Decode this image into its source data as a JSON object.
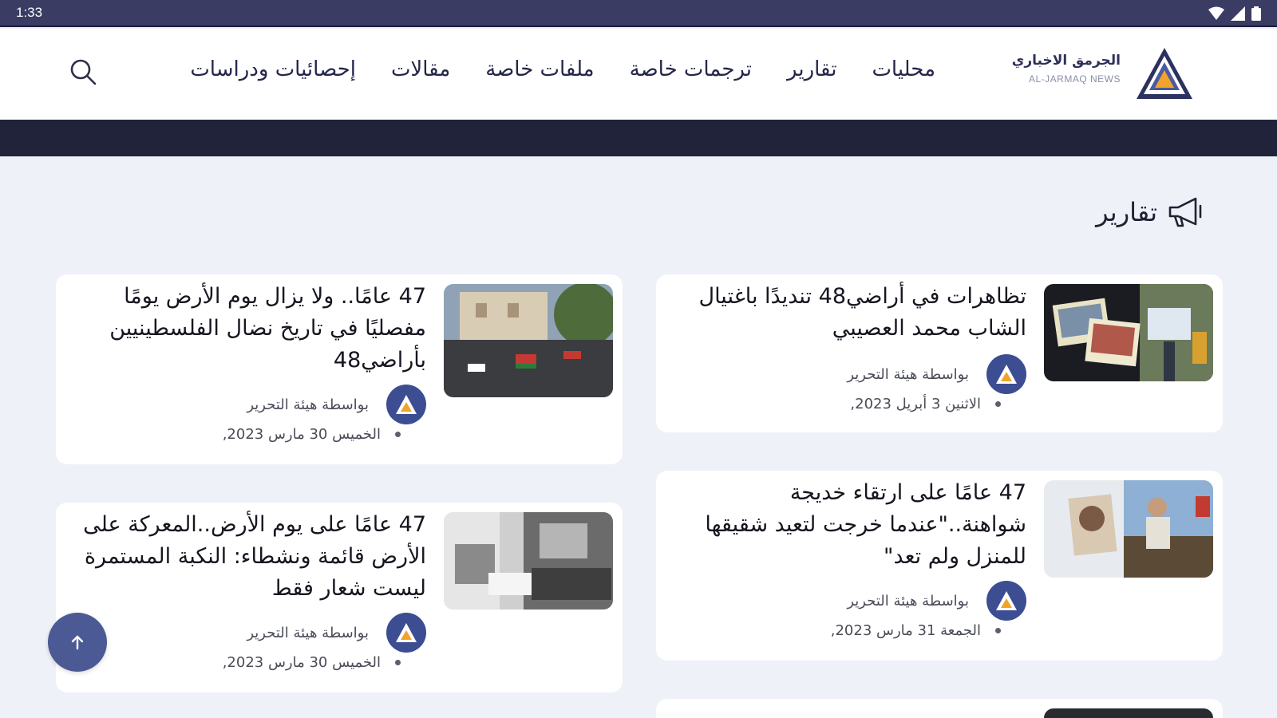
{
  "status_bar": {
    "time": "1:33",
    "icons": [
      "wifi-icon",
      "signal-icon",
      "battery-icon"
    ]
  },
  "brand": {
    "name_ar": "الجرمق الاخباري",
    "name_en": "AL-JARMAQ NEWS"
  },
  "nav": {
    "items": [
      {
        "label": "محليات"
      },
      {
        "label": "تقارير"
      },
      {
        "label": "ترجمات خاصة"
      },
      {
        "label": "ملفات خاصة"
      },
      {
        "label": "مقالات"
      },
      {
        "label": "إحصائيات ودراسات"
      }
    ],
    "search_icon": "search-icon"
  },
  "section": {
    "title": "تقارير",
    "icon": "megaphone-icon"
  },
  "articles": [
    {
      "title": "تظاهرات في أراضي48 تنديدًا باغتيال الشاب محمد العصيبي",
      "author": "بواسطة هيئة التحرير",
      "date": "الاثنين 3 أبريل 2023,"
    },
    {
      "title": "47 عامًا.. ولا يزال يوم الأرض يومًا مفصليًا في تاريخ نضال الفلسطينيين بأراضي48",
      "author": "بواسطة هيئة التحرير",
      "date": "الخميس 30 مارس 2023,"
    },
    {
      "title": "47 عامًا على ارتقاء خديجة شواهنة..\"عندما خرجت لتعيد شقيقها للمنزل ولم تعد\"",
      "author": "بواسطة هيئة التحرير",
      "date": "الجمعة 31 مارس 2023,"
    },
    {
      "title": "47  عامًا على يوم الأرض..المعركة على الأرض قائمة ونشطاء: النكبة المستمرة ليست شعار فقط",
      "author": "بواسطة هيئة التحرير",
      "date": "الخميس 30 مارس 2023,"
    }
  ],
  "colors": {
    "primary": "#3c4d92",
    "dark_band": "#20233a",
    "status_bar": "#3a3c63",
    "background": "#eef1f7"
  }
}
